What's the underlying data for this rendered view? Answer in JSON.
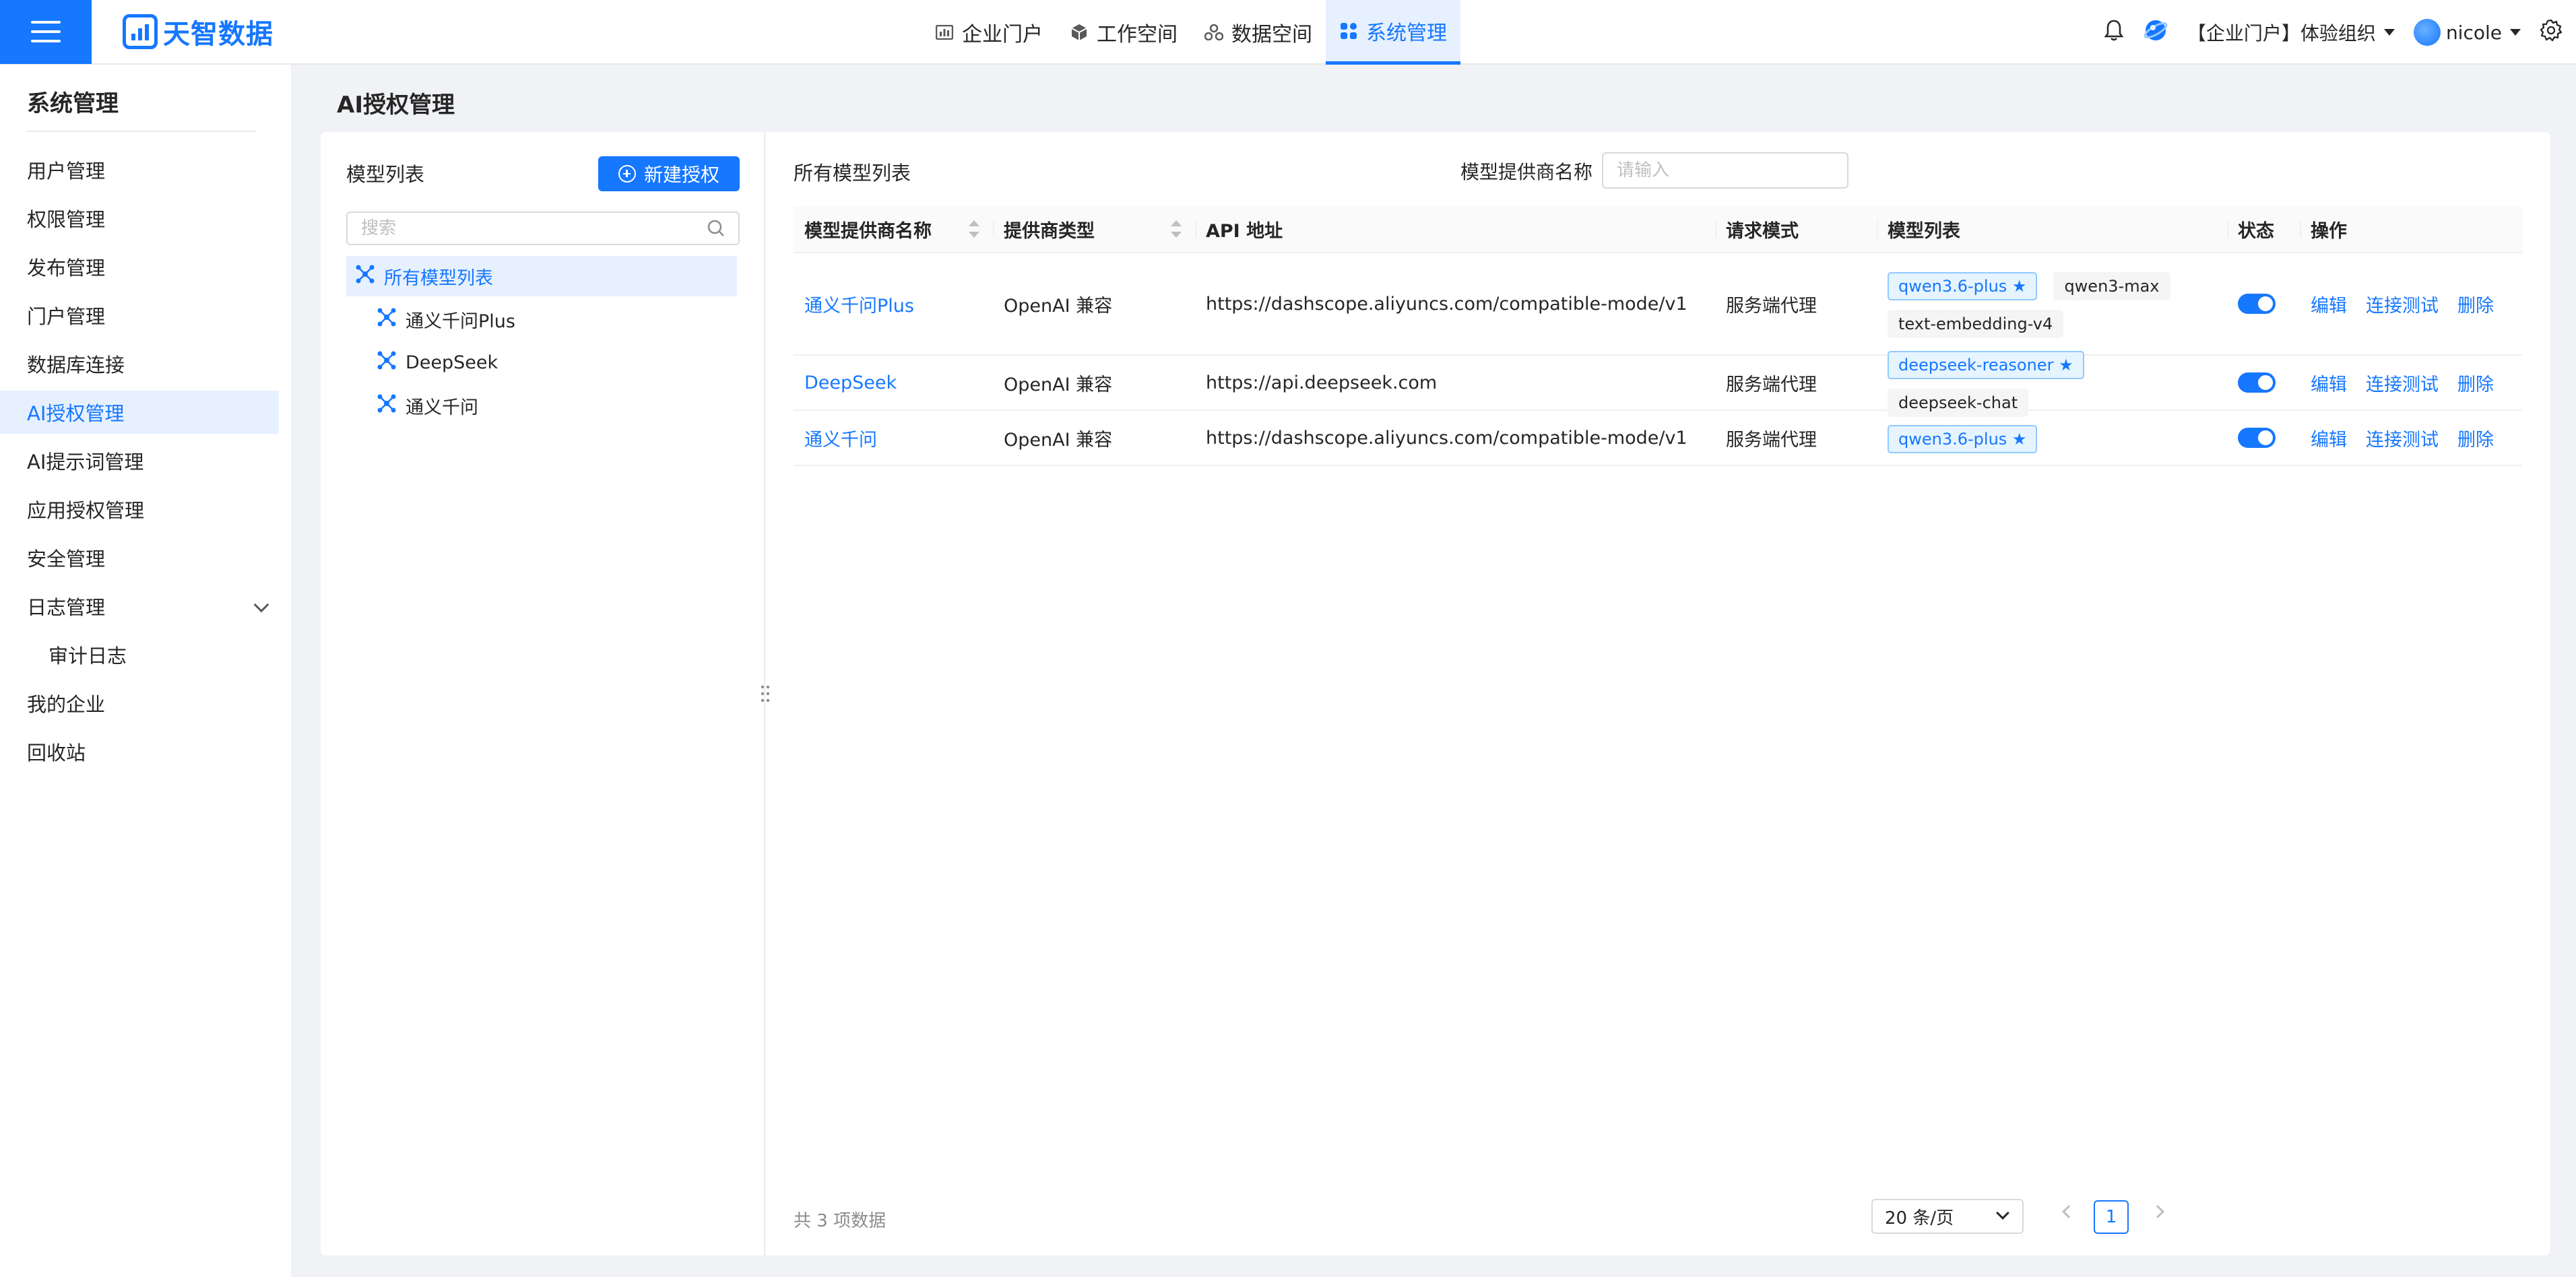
{
  "header": {
    "app_name": "天智数据",
    "nav": [
      {
        "label": "企业门户",
        "icon": "dashboard-icon"
      },
      {
        "label": "工作空间",
        "icon": "cube-icon"
      },
      {
        "label": "数据空间",
        "icon": "cluster-icon"
      },
      {
        "label": "系统管理",
        "icon": "grid-icon"
      }
    ],
    "active_nav": "系统管理",
    "org_label": "【企业门户】体验组织",
    "user_name": "nicole"
  },
  "sidebar": {
    "title": "系统管理",
    "items": [
      {
        "label": "用户管理"
      },
      {
        "label": "权限管理"
      },
      {
        "label": "发布管理"
      },
      {
        "label": "门户管理"
      },
      {
        "label": "数据库连接"
      },
      {
        "label": "AI授权管理"
      },
      {
        "label": "AI提示词管理"
      },
      {
        "label": "应用授权管理"
      },
      {
        "label": "安全管理"
      },
      {
        "label": "日志管理"
      },
      {
        "label": "审计日志"
      },
      {
        "label": "我的企业"
      },
      {
        "label": "回收站"
      }
    ],
    "active_item": "AI授权管理"
  },
  "page": {
    "title": "AI授权管理"
  },
  "model_panel": {
    "title": "模型列表",
    "new_button": "新建授权",
    "search_placeholder": "搜索",
    "tree": [
      {
        "label": "所有模型列表"
      },
      {
        "label": "通义千问Plus"
      },
      {
        "label": "DeepSeek"
      },
      {
        "label": "通义千问"
      }
    ]
  },
  "list_panel": {
    "title": "所有模型列表",
    "filter_label": "模型提供商名称",
    "filter_placeholder": "请输入",
    "columns": [
      "模型提供商名称",
      "提供商类型",
      "API 地址",
      "请求模式",
      "模型列表",
      "状态",
      "操作"
    ],
    "rows": [
      {
        "name": "通义千问Plus",
        "type": "OpenAI 兼容",
        "api": "https://dashscope.aliyuncs.com/compatible-mode/v1",
        "mode": "服务端代理",
        "models": [
          "qwen3.6-plus ★",
          "qwen3-max",
          "text-embedding-v4"
        ],
        "enabled": true
      },
      {
        "name": "DeepSeek",
        "type": "OpenAI 兼容",
        "api": "https://api.deepseek.com",
        "mode": "服务端代理",
        "models": [
          "deepseek-reasoner ★",
          "deepseek-chat"
        ],
        "enabled": true
      },
      {
        "name": "通义千问",
        "type": "OpenAI 兼容",
        "api": "https://dashscope.aliyuncs.com/compatible-mode/v1",
        "mode": "服务端代理",
        "models": [
          "qwen3.6-plus ★"
        ],
        "enabled": true
      }
    ],
    "actions": {
      "edit": "编辑",
      "test": "连接测试",
      "delete": "删除"
    },
    "total": "共 3 项数据",
    "page_size": "20 条/页",
    "current_page": "1"
  },
  "colors": {
    "primary": "#1677ff",
    "active_bg": "#e6f0ff"
  }
}
